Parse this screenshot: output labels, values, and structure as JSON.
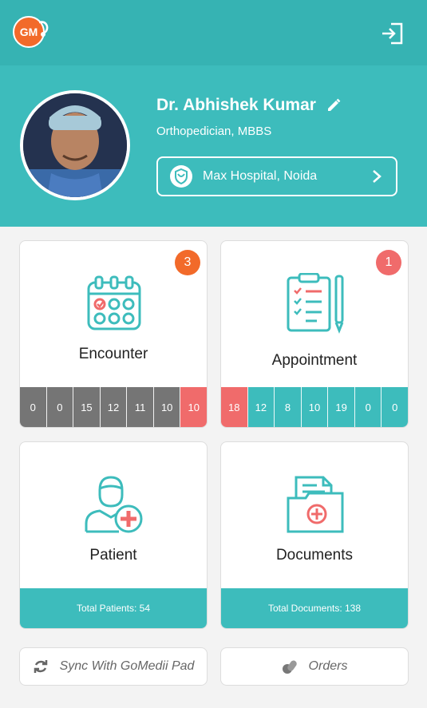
{
  "colors": {
    "teal": "#3dbcbc",
    "grey": "#757575",
    "red": "#f06b6b",
    "orange": "#f26a2a"
  },
  "header": {
    "logo_text": "GM"
  },
  "profile": {
    "name": "Dr. Abhishek Kumar",
    "specialization": "Orthopedician, MBBS",
    "hospital": "Max Hospital, Noida"
  },
  "cards": {
    "encounter": {
      "title": "Encounter",
      "badge": "3",
      "stats": [
        "0",
        "0",
        "15",
        "12",
        "11",
        "10",
        "10"
      ]
    },
    "appointment": {
      "title": "Appointment",
      "badge": "1",
      "stats": [
        "18",
        "12",
        "8",
        "10",
        "19",
        "0",
        "0"
      ]
    },
    "patient": {
      "title": "Patient",
      "footer": "Total Patients: 54"
    },
    "documents": {
      "title": "Documents",
      "footer": "Total Documents: 138"
    }
  },
  "actions": {
    "sync": "Sync With GoMedii Pad",
    "orders": "Orders"
  }
}
